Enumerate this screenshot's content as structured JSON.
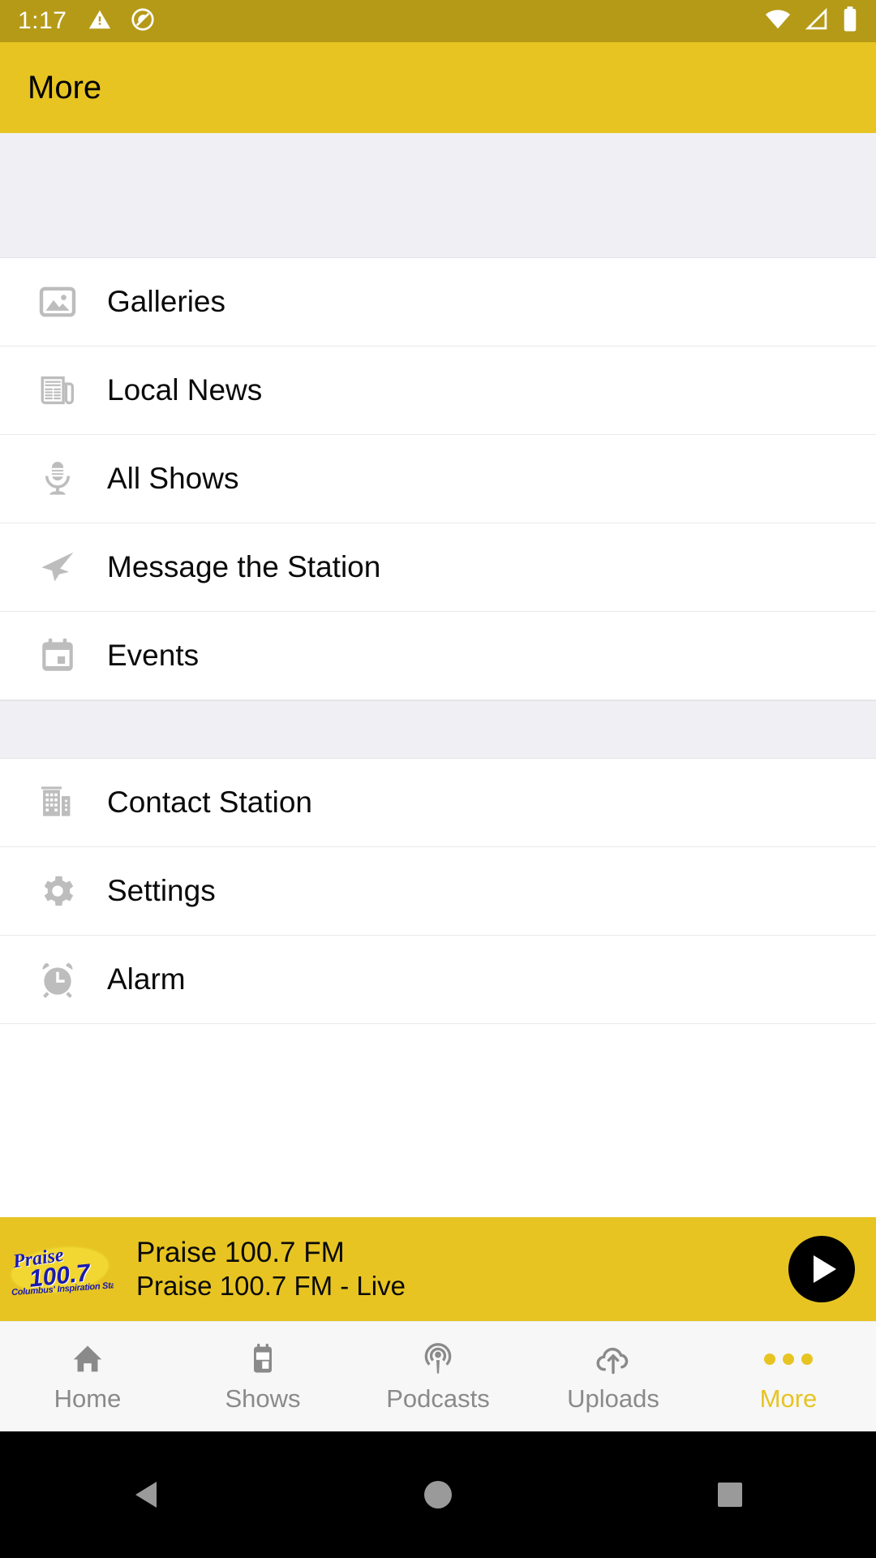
{
  "status_bar": {
    "time": "1:17",
    "icons": [
      "warning-triangle-icon",
      "do-not-disturb-icon",
      "wifi-icon",
      "cellular-signal-icon",
      "battery-icon"
    ]
  },
  "app_bar": {
    "title": "More"
  },
  "menu": {
    "group_one": [
      {
        "label": "Galleries",
        "icon": "image-icon"
      },
      {
        "label": "Local News",
        "icon": "newspaper-icon"
      },
      {
        "label": "All Shows",
        "icon": "microphone-icon"
      },
      {
        "label": "Message the Station",
        "icon": "paper-plane-icon"
      },
      {
        "label": "Events",
        "icon": "calendar-icon"
      }
    ],
    "group_two": [
      {
        "label": "Contact Station",
        "icon": "building-icon"
      },
      {
        "label": "Settings",
        "icon": "gear-icon"
      },
      {
        "label": "Alarm",
        "icon": "alarm-clock-icon"
      }
    ]
  },
  "player": {
    "logo_brand": "Praise",
    "logo_frequency": "100.7",
    "logo_tagline": "Columbus' Inspiration Station",
    "title": "Praise 100.7 FM",
    "subtitle": "Praise 100.7 FM  - Live",
    "play_icon": "play-icon"
  },
  "tab_bar": {
    "tabs": [
      {
        "label": "Home",
        "icon": "home-icon",
        "active": false
      },
      {
        "label": "Shows",
        "icon": "calendar-icon",
        "active": false
      },
      {
        "label": "Podcasts",
        "icon": "podcast-icon",
        "active": false
      },
      {
        "label": "Uploads",
        "icon": "cloud-upload-icon",
        "active": false
      },
      {
        "label": "More",
        "icon": "more-dots-icon",
        "active": true
      }
    ]
  },
  "nav_bar": {
    "back": "back-triangle-icon",
    "home": "home-circle-icon",
    "recents": "recents-square-icon"
  },
  "colors": {
    "status_bar_bg": "#B59A18",
    "app_bar_bg": "#E7C422",
    "accent": "#E7C422",
    "section_gap": "#F0F0F4",
    "icon_gray": "#BDBDBD",
    "tab_inactive": "#8A8A8A",
    "logo_blue": "#1A1AAE"
  }
}
